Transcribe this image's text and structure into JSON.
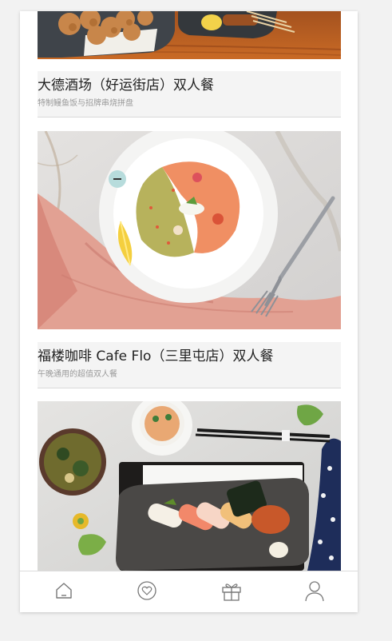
{
  "feed": {
    "cards": [
      {
        "title": "大德酒场（好运街店）双人餐",
        "subtitle": "特制鳗鱼饭与招牌串烧拼盘",
        "image": "fried-chicken-skewers-photo"
      },
      {
        "title": "福楼咖啡 Cafe Flo（三里屯店）双人餐",
        "subtitle": "午晚通用的超值双人餐",
        "image": "salmon-carpaccio-plate-photo"
      },
      {
        "title": "",
        "subtitle": "",
        "image": "sushi-set-photo"
      }
    ]
  },
  "tabbar": {
    "tabs": [
      {
        "icon": "home-icon"
      },
      {
        "icon": "heart-icon"
      },
      {
        "icon": "gift-icon"
      },
      {
        "icon": "user-icon"
      }
    ],
    "icon_color": "#777777"
  }
}
